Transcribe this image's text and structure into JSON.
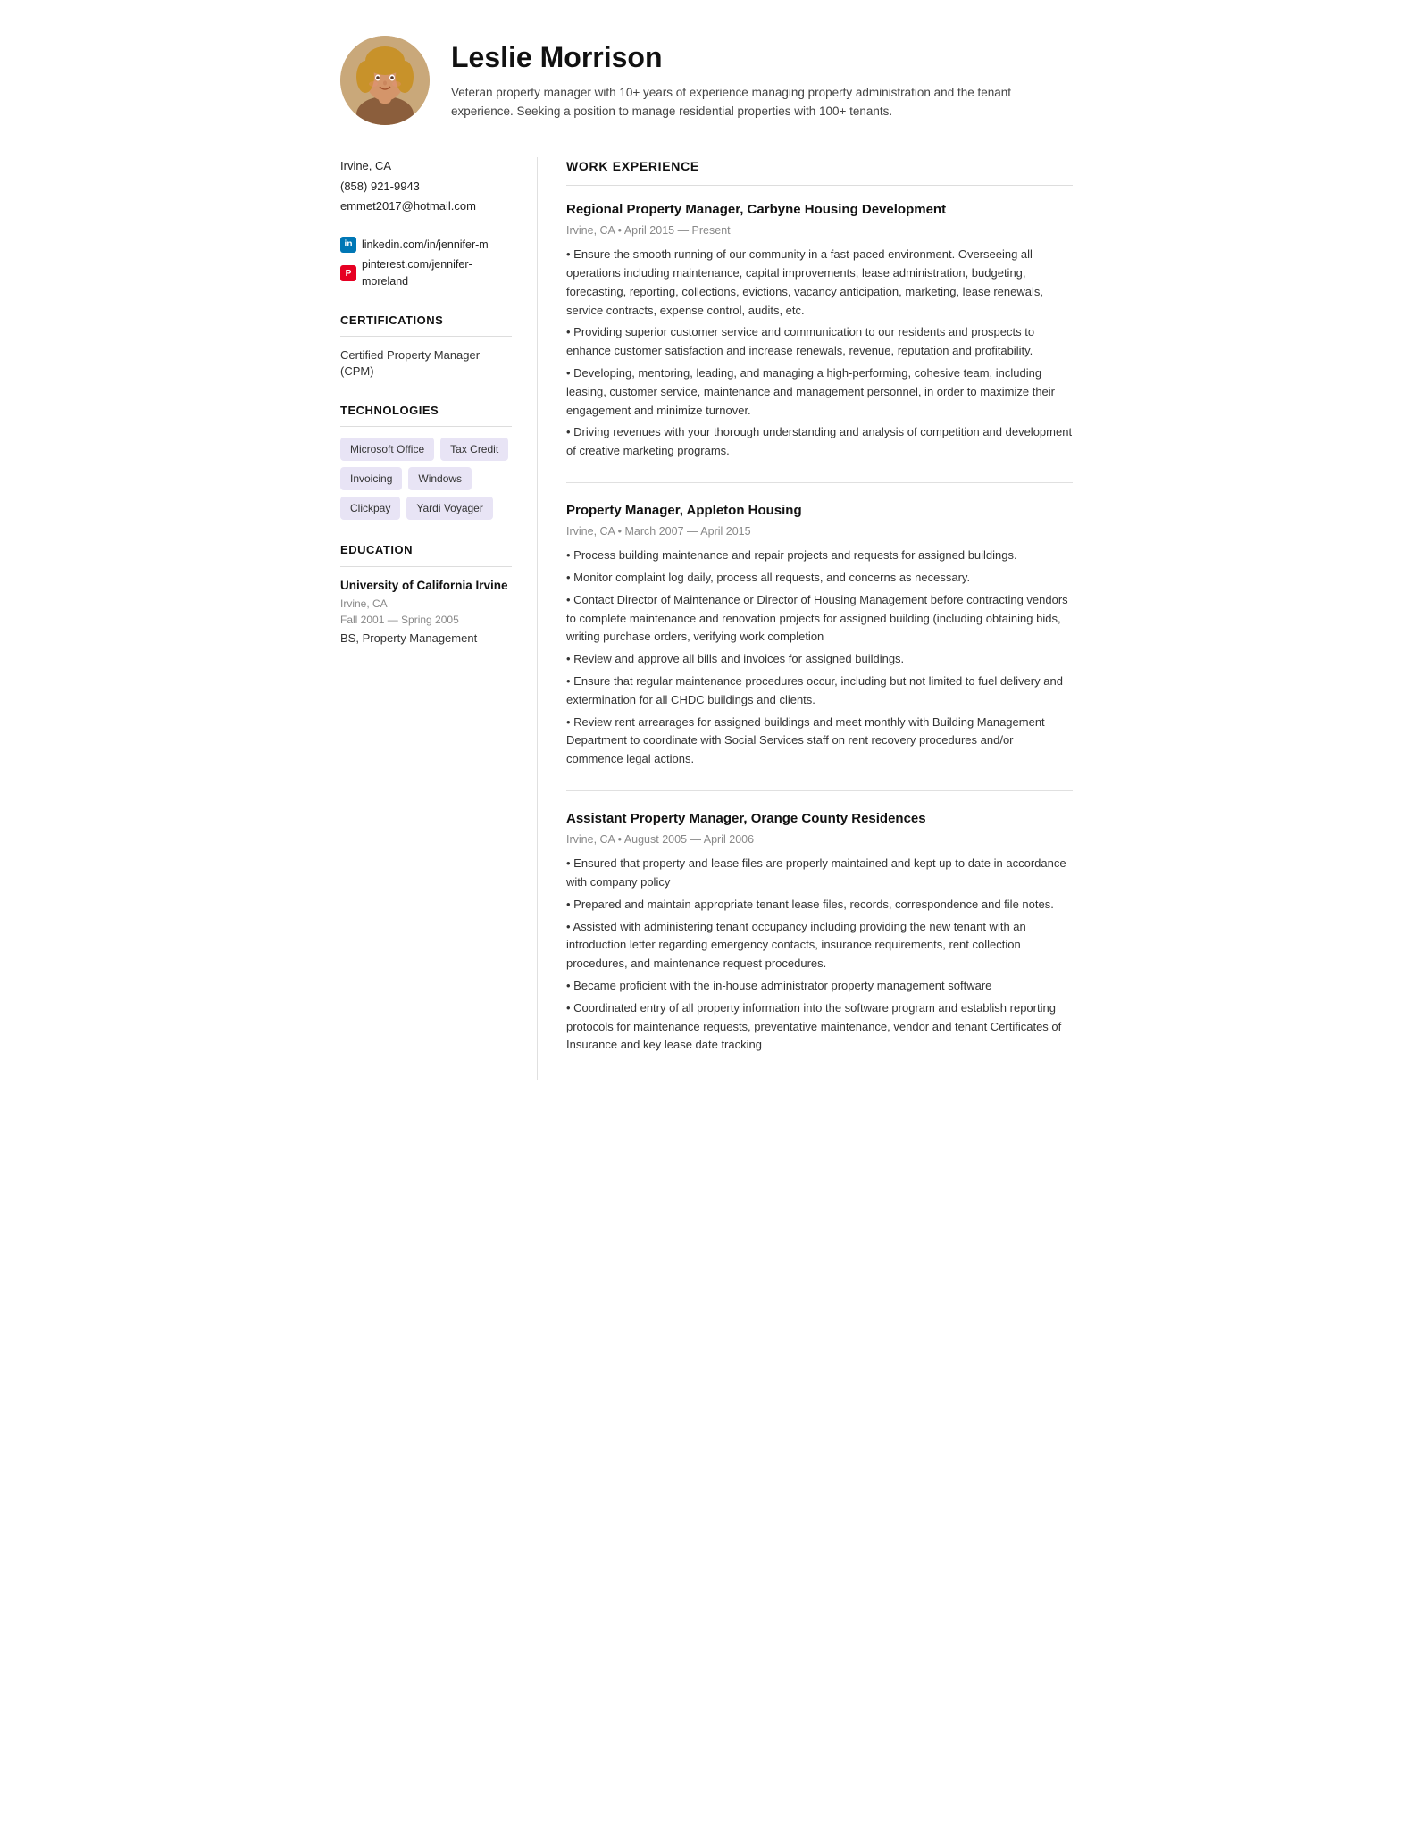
{
  "header": {
    "name": "Leslie Morrison",
    "summary": "Veteran property manager with 10+ years of experience managing property administration and the tenant experience. Seeking a position to manage residential properties with 100+ tenants."
  },
  "sidebar": {
    "contact": {
      "location": "Irvine, CA",
      "phone": "(858) 921-9943",
      "email": "emmet2017@hotmail.com"
    },
    "social": [
      {
        "platform": "linkedin",
        "label": "linkedin.com/in/jennifer-m",
        "icon": "in"
      },
      {
        "platform": "pinterest",
        "label": "pinterest.com/jennifer-moreland",
        "icon": "P"
      }
    ],
    "certifications_heading": "CERTIFICATIONS",
    "certifications": [
      "Certified Property Manager (CPM)"
    ],
    "technologies_heading": "TECHNOLOGIES",
    "technologies": [
      "Microsoft Office",
      "Tax Credit",
      "Invoicing",
      "Windows",
      "Clickpay",
      "Yardi Voyager"
    ],
    "education_heading": "EDUCATION",
    "education": [
      {
        "school": "University of California Irvine",
        "location": "Irvine, CA",
        "dates": "Fall 2001 — Spring 2005",
        "degree": "BS, Property Management"
      }
    ]
  },
  "work_experience": {
    "heading": "WORK EXPERIENCE",
    "jobs": [
      {
        "title": "Regional Property Manager, Carbyne Housing Development",
        "meta": "Irvine, CA • April 2015 — Present",
        "bullets": [
          "• Ensure the smooth running of our community in a fast-paced environment. Overseeing all operations including maintenance, capital improvements, lease administration, budgeting, forecasting, reporting, collections, evictions, vacancy anticipation, marketing, lease renewals, service contracts, expense control, audits, etc.",
          "• Providing superior customer service and communication to our residents and prospects to enhance customer satisfaction and increase renewals, revenue, reputation and profitability.",
          "• Developing, mentoring, leading, and managing a high-performing, cohesive team, including leasing, customer service, maintenance and management personnel, in order to maximize their engagement and minimize turnover.",
          "• Driving revenues with your thorough understanding and analysis of competition and development of creative marketing programs."
        ]
      },
      {
        "title": "Property Manager, Appleton Housing",
        "meta": "Irvine, CA • March 2007 — April 2015",
        "bullets": [
          "• Process building maintenance and repair projects and requests for assigned buildings.",
          "• Monitor complaint log daily, process all requests, and concerns as necessary.",
          "• Contact Director of Maintenance or Director of Housing Management before contracting vendors to complete maintenance and renovation projects for assigned building (including obtaining bids, writing purchase orders, verifying work completion",
          "• Review and approve all bills and invoices for assigned buildings.",
          "• Ensure that regular maintenance procedures occur, including but not limited to fuel delivery and extermination for all CHDC buildings and clients.",
          "• Review rent arrearages for assigned buildings and meet monthly with Building Management Department to coordinate with Social Services staff on rent recovery procedures and/or commence legal actions."
        ]
      },
      {
        "title": "Assistant Property Manager, Orange County Residences",
        "meta": "Irvine, CA • August 2005 — April 2006",
        "bullets": [
          "• Ensured that property and lease files are properly maintained and kept up to date in accordance with company policy",
          "• Prepared and maintain appropriate tenant lease files, records, correspondence and file notes.",
          "• Assisted with administering tenant occupancy including providing the new tenant with an introduction letter regarding emergency contacts, insurance requirements, rent collection procedures, and maintenance request procedures.",
          "• Became proficient with the in-house administrator property management software",
          "• Coordinated entry of all property information into the software program and establish reporting protocols for maintenance requests, preventative maintenance, vendor and tenant Certificates of Insurance and key lease date tracking"
        ]
      }
    ]
  }
}
